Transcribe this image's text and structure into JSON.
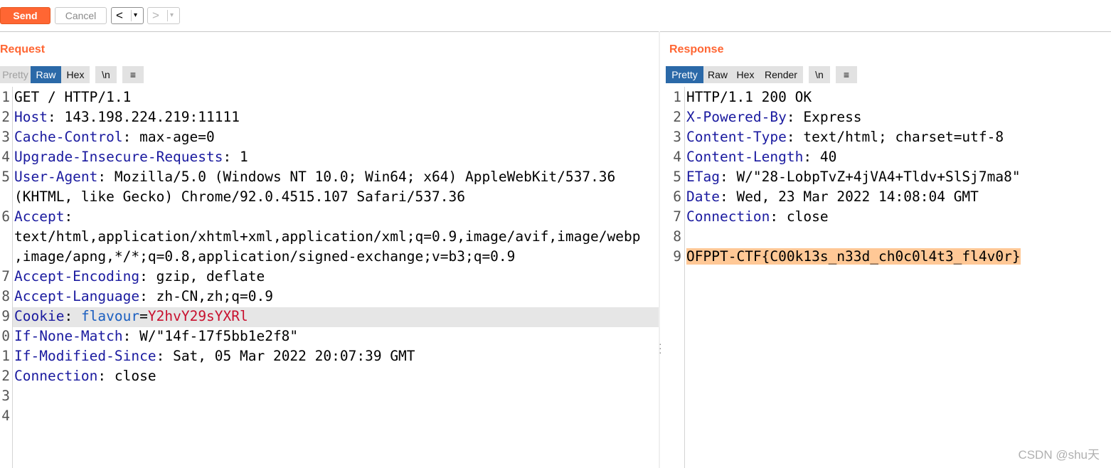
{
  "toolbar": {
    "send_label": "Send",
    "cancel_label": "Cancel",
    "back_arrow": "<",
    "forward_arrow": ">",
    "dropdown_glyph": "▾"
  },
  "request": {
    "title": "Request",
    "tabs": [
      "Pretty",
      "Raw",
      "Hex",
      "\\n",
      "≡"
    ],
    "active_tab": "Raw",
    "line_numbers": [
      "1",
      "2",
      "3",
      "4",
      "5",
      "6",
      "7",
      "8",
      "9",
      "0",
      "1",
      "2",
      "3",
      "4"
    ],
    "lines": {
      "l1": "GET / HTTP/1.1",
      "l2_k": "Host",
      "l2_v": ": 143.198.224.219:11111",
      "l3_k": "Cache-Control",
      "l3_v": ": max-age=0",
      "l4_k": "Upgrade-Insecure-Requests",
      "l4_v": ": 1",
      "l5_k": "User-Agent",
      "l5_v": ": Mozilla/5.0 (Windows NT 10.0; Win64; x64) AppleWebKit/537.36",
      "l5_cont": "(KHTML, like Gecko) Chrome/92.0.4515.107 Safari/537.36",
      "l6_k": "Accept",
      "l6_v": ":",
      "l6_cont1": "text/html,application/xhtml+xml,application/xml;q=0.9,image/avif,image/webp",
      "l6_cont2": ",image/apng,*/*;q=0.8,application/signed-exchange;v=b3;q=0.9",
      "l7_k": "Accept-Encoding",
      "l7_v": ": gzip, deflate",
      "l8_k": "Accept-Language",
      "l8_v": ": zh-CN,zh;q=0.9",
      "l9_k": "Cookie",
      "l9_sep": ": ",
      "l9_ck": "flavour",
      "l9_eq": "=",
      "l9_cv": "Y2hvY29sYXRl",
      "l10_k": "If-None-Match",
      "l10_v": ": W/\"14f-17f5bb1e2f8\"",
      "l11_k": "If-Modified-Since",
      "l11_v": ": Sat, 05 Mar 2022 20:07:39 GMT",
      "l12_k": "Connection",
      "l12_v": ": close"
    }
  },
  "response": {
    "title": "Response",
    "tabs": [
      "Pretty",
      "Raw",
      "Hex",
      "Render",
      "\\n",
      "≡"
    ],
    "active_tab": "Pretty",
    "line_numbers": [
      "1",
      "2",
      "3",
      "4",
      "5",
      "6",
      "7",
      "8",
      "9"
    ],
    "lines": {
      "l1": "HTTP/1.1 200 OK",
      "l2_k": "X-Powered-By",
      "l2_v": ": Express",
      "l3_k": "Content-Type",
      "l3_v": ": text/html; charset=utf-8",
      "l4_k": "Content-Length",
      "l4_v": ": 40",
      "l5_k": "ETag",
      "l5_v": ": W/\"28-LobpTvZ+4jVA4+Tldv+SlSj7ma8\"",
      "l6_k": "Date",
      "l6_v": ": Wed, 23 Mar 2022 14:08:04 GMT",
      "l7_k": "Connection",
      "l7_v": ": close",
      "l9": "OFPPT-CTF{C00k13s_n33d_ch0c0l4t3_fl4v0r}"
    }
  },
  "watermark": "CSDN @shu天",
  "colors": {
    "accent": "#ff6633",
    "active_tab": "#2b69a8",
    "header_key": "#1a1a9f",
    "cookie_value": "#c8102e",
    "flag_highlight": "#ffc896"
  }
}
